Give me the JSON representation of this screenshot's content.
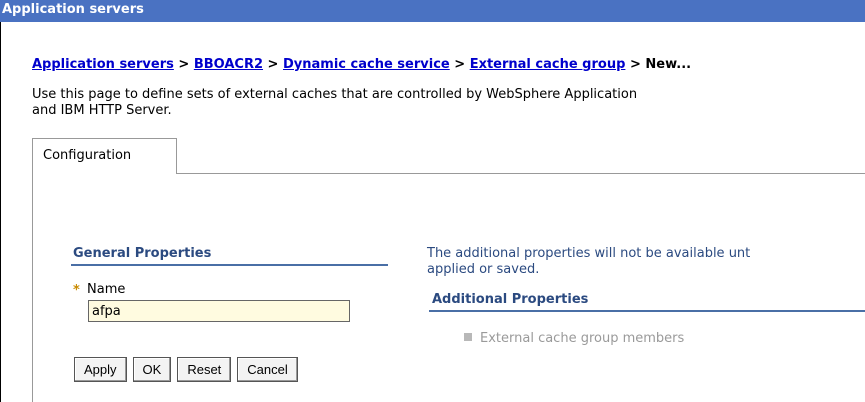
{
  "window": {
    "title": "Application servers"
  },
  "breadcrumb": {
    "items": [
      "Application servers",
      "BBOACR2",
      "Dynamic cache service",
      "External cache group"
    ],
    "separator": ">",
    "current": "New..."
  },
  "description": {
    "line1": "Use this page to define sets of external caches that are controlled by WebSphere Application",
    "line2": "and IBM HTTP Server."
  },
  "tabs": [
    {
      "label": "Configuration"
    }
  ],
  "general_properties": {
    "title": "General Properties",
    "required_marker": "*",
    "name_label": "Name",
    "name_value": "afpa"
  },
  "note": {
    "line1": "The additional properties will not be available unt",
    "line2": "applied or saved."
  },
  "additional_properties": {
    "title": "Additional Properties",
    "items": [
      "External cache group members"
    ]
  },
  "buttons": {
    "apply": "Apply",
    "ok": "OK",
    "reset": "Reset",
    "cancel": "Cancel"
  },
  "colors": {
    "titlebar": "#4a72c2",
    "link": "#0000cc",
    "section": "#2b4a80",
    "input_bg": "#fffbe0"
  }
}
